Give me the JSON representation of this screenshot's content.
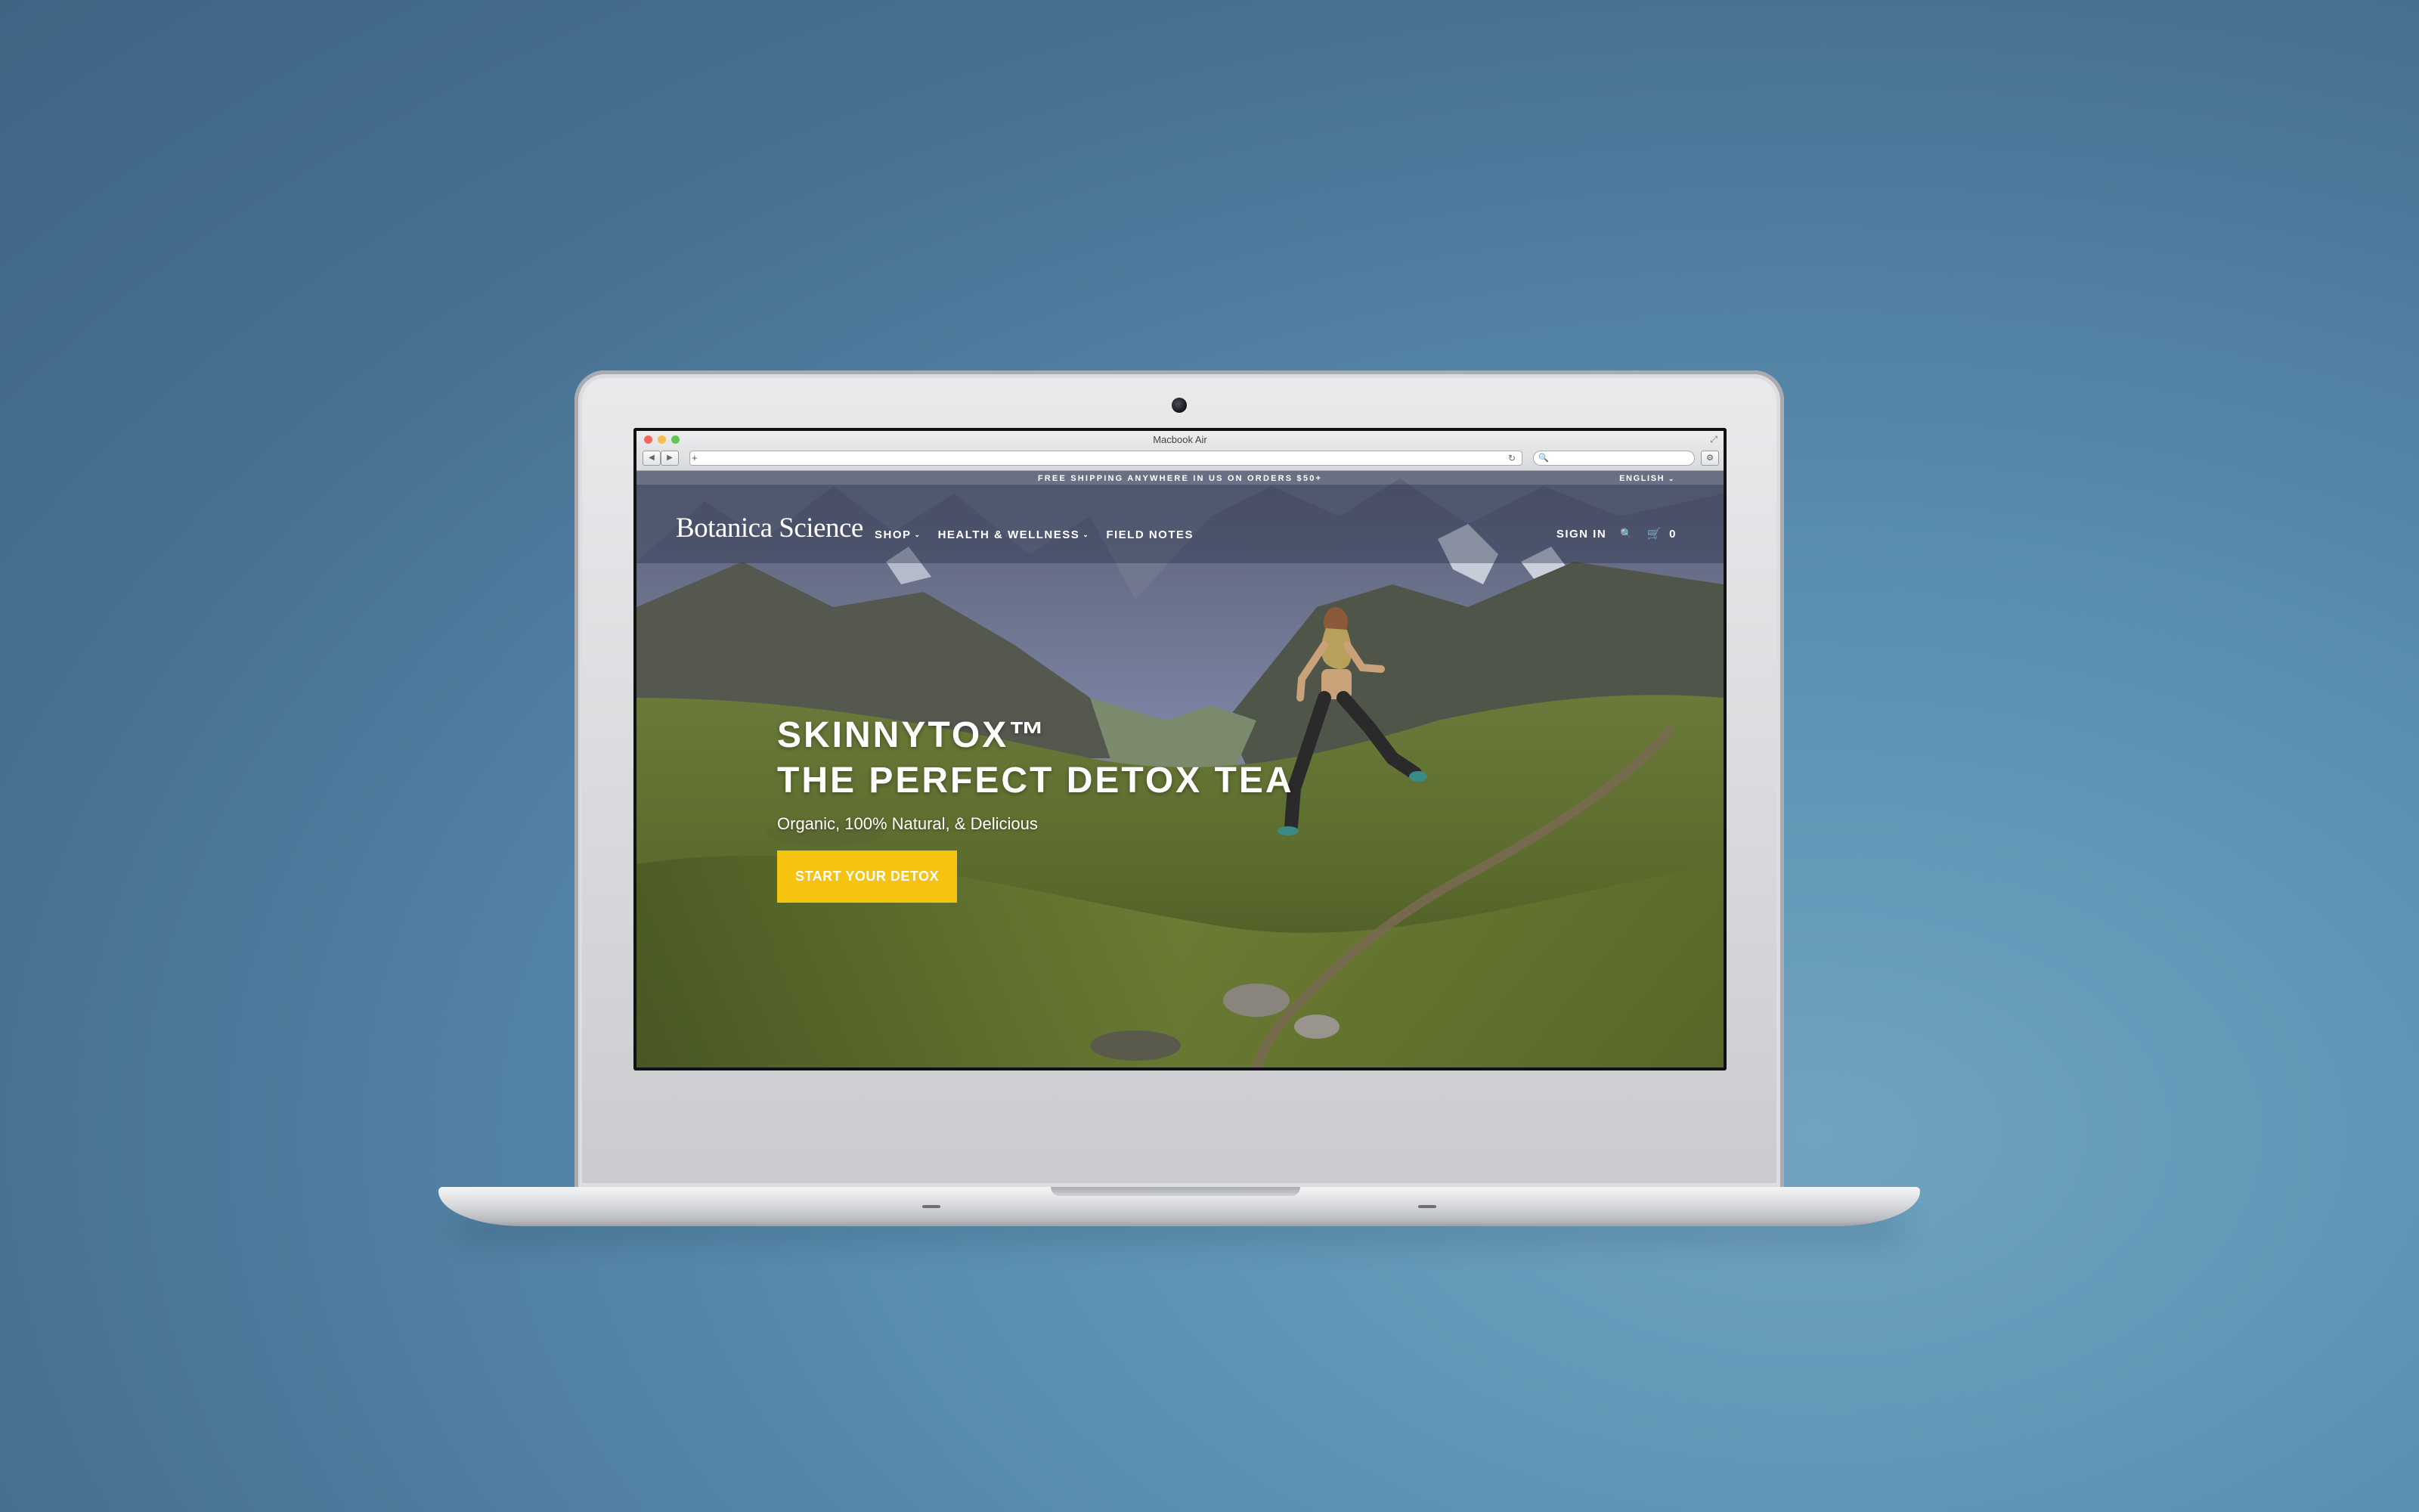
{
  "browser": {
    "window_title": "Macbook Air",
    "back_glyph": "◀",
    "forward_glyph": "▶",
    "new_tab_glyph": "+",
    "reload_glyph": "↻",
    "search_glyph": "🔍",
    "settings_glyph": "⚙",
    "resize_glyph": "⤢",
    "url_value": "",
    "search_value": "",
    "colors": {
      "close": "#ed6a5e",
      "minimize": "#f5bf4f",
      "zoom": "#61c554"
    }
  },
  "site": {
    "promo": "FREE SHIPPING ANYWHERE IN US ON ORDERS $50+",
    "language": "ENGLISH",
    "language_chevron": "⌄",
    "logo": "Botanica Science",
    "nav": [
      {
        "label": "SHOP",
        "chevron": "⌄"
      },
      {
        "label": "HEALTH & WELLNESS",
        "chevron": "⌄"
      },
      {
        "label": "FIELD NOTES"
      }
    ],
    "sign_in": "SIGN IN",
    "search_icon": "🔍",
    "cart_icon": "🛒",
    "cart_count": "0"
  },
  "hero": {
    "title_line1": "SKINNYTOX™",
    "title_line2": "THE PERFECT DETOX TEA",
    "subtitle": "Organic, 100% Natural, & Delicious",
    "cta": "START YOUR DETOX",
    "cta_color": "#f5c310"
  }
}
